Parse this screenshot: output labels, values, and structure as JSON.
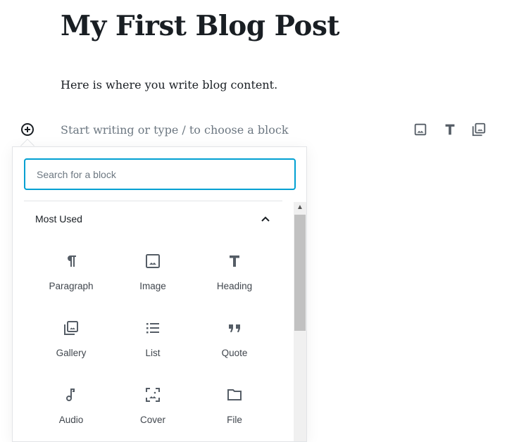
{
  "post": {
    "title": "My First Blog Post",
    "paragraph": "Here is where you write blog content.",
    "placeholder": "Start writing or type / to choose a block"
  },
  "toolbar": {
    "icons": [
      "image-icon",
      "heading-icon",
      "gallery-icon"
    ]
  },
  "inserter": {
    "search_placeholder": "Search for a block",
    "section_title": "Most Used",
    "section_expanded": true,
    "accent_color": "#00a0d2",
    "blocks": [
      {
        "label": "Paragraph",
        "icon": "paragraph-icon"
      },
      {
        "label": "Image",
        "icon": "image-icon"
      },
      {
        "label": "Heading",
        "icon": "heading-icon"
      },
      {
        "label": "Gallery",
        "icon": "gallery-icon"
      },
      {
        "label": "List",
        "icon": "list-icon"
      },
      {
        "label": "Quote",
        "icon": "quote-icon"
      },
      {
        "label": "Audio",
        "icon": "audio-icon"
      },
      {
        "label": "Cover",
        "icon": "cover-icon"
      },
      {
        "label": "File",
        "icon": "file-icon"
      }
    ]
  }
}
